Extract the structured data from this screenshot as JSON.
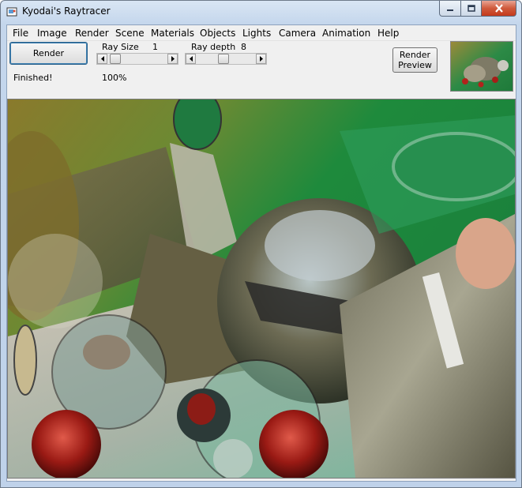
{
  "window": {
    "title": "Kyodai's Raytracer"
  },
  "menu": [
    "File",
    "Image",
    "Render",
    "Scene",
    "Materials",
    "Objects",
    "Lights",
    "Camera",
    "Animation",
    "Help"
  ],
  "toolbar": {
    "render_label": "Render",
    "render_preview_line1": "Render",
    "render_preview_line2": "Preview",
    "ray_size_label": "Ray Size",
    "ray_size_value": "1",
    "ray_size_level": 0.05,
    "ray_depth_label": "Ray depth",
    "ray_depth_value": "8",
    "ray_depth_level": 0.45
  },
  "status": {
    "text": "Finished!",
    "progress": "100%"
  },
  "colors": {
    "accent": "#3c7fb1",
    "client_bg": "#f0f0f0",
    "close_button": "#c4391b"
  },
  "icons": [
    "app-icon",
    "minimize-icon",
    "maximize-icon",
    "close-icon",
    "arrow-left-icon",
    "arrow-right-icon"
  ]
}
